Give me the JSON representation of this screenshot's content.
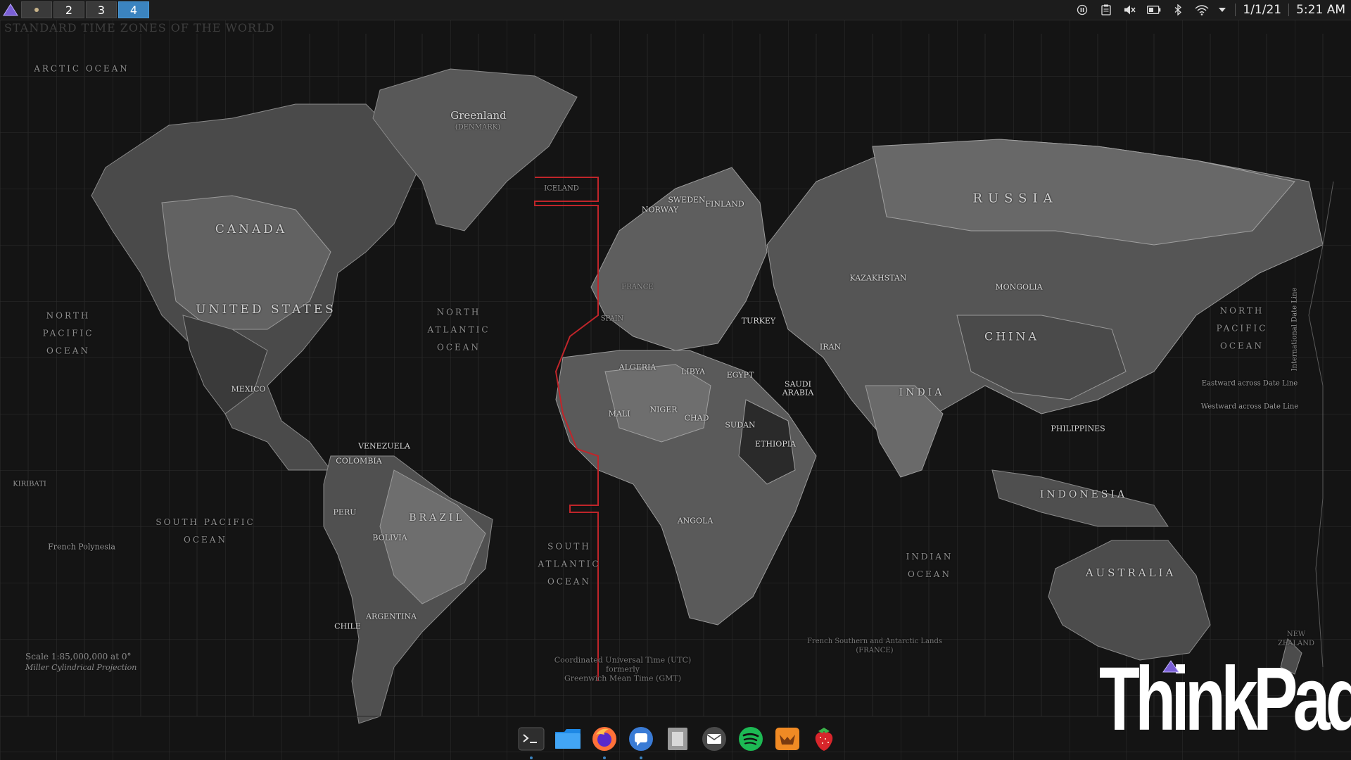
{
  "topbar": {
    "workspaces": [
      {
        "label": "",
        "active": false
      },
      {
        "label": "2",
        "active": false
      },
      {
        "label": "3",
        "active": false
      },
      {
        "label": "4",
        "active": true
      }
    ],
    "tray_icons": [
      "pause-icon",
      "clipboard-icon",
      "volume-muted-icon",
      "battery-icon",
      "bluetooth-icon",
      "wifi-icon",
      "dropdown-arrow-icon"
    ],
    "date": "1/1/21",
    "time": "5:21 AM"
  },
  "wallpaper": {
    "title": "STANDARD TIME ZONES OF THE WORLD",
    "countries": {
      "canada": "CANADA",
      "united_states": "UNITED STATES",
      "mexico": "MEXICO",
      "brazil": "BRAZIL",
      "russia": "RUSSIA",
      "china": "CHINA",
      "india": "INDIA",
      "australia": "AUSTRALIA",
      "indonesia": "INDONESIA",
      "greenland": "Greenland",
      "greenland_sub": "(DENMARK)",
      "algeria": "ALGERIA",
      "libya": "LIBYA",
      "egypt": "EGYPT",
      "sudan": "SUDAN",
      "saudi": "SAUDI",
      "arabia": "ARABIA",
      "iran": "IRAN",
      "kazakhstan": "KAZAKHSTAN",
      "mongolia": "MONGOLIA",
      "niger": "NIGER",
      "chad": "CHAD",
      "mali": "MALI",
      "angola": "ANGOLA",
      "argentina": "ARGENTINA",
      "peru": "PERU",
      "bolivia": "BOLIVIA",
      "colombia": "COLOMBIA",
      "venezuela": "VENEZUELA",
      "ethiopia": "ETHIOPIA",
      "finland": "FINLAND",
      "sweden": "SWEDEN",
      "norway": "NORWAY",
      "turkey": "TURKEY",
      "philippines": "PHILIPPINES",
      "chile": "CHILE",
      "iceland": "ICELAND",
      "spain": "SPAIN",
      "france": "FRANCE",
      "kiribati": "KIRIBATI",
      "french_polynesia": "French Polynesia"
    },
    "oceans": {
      "arctic": "ARCTIC OCEAN",
      "north_pacific_w": "NORTH\nPACIFIC\nOCEAN",
      "north_atlantic": "NORTH\nATLANTIC\nOCEAN",
      "south_pacific": "SOUTH PACIFIC\nOCEAN",
      "south_atlantic": "SOUTH\nATLANTIC\nOCEAN",
      "indian": "INDIAN\nOCEAN",
      "north_pacific_e": "NORTH\nPACIFIC\nOCEAN"
    },
    "scale_text": "Scale 1:85,000,000 at 0°",
    "projection_text": "Miller Cylindrical Projection",
    "utc_note": "Coordinated Universal Time (UTC)\nformerly\nGreenwich Mean Time (GMT)",
    "date_line": "International Date Line",
    "eastward": "Eastward across Date Line",
    "westward": "Westward across Date Line",
    "french_southern": "French Southern and Antarctic Lands\n(FRANCE)",
    "new_zealand": "NEW\nZEALAND"
  },
  "logo": {
    "text": "ThinkPad"
  },
  "dock": {
    "items": [
      {
        "name": "terminal",
        "color": "#2e2e2e"
      },
      {
        "name": "files",
        "color": "#1e88e5"
      },
      {
        "name": "firefox",
        "color": "#ff7139"
      },
      {
        "name": "messages",
        "color": "#3a7bd5"
      },
      {
        "name": "archive",
        "color": "#8a8a8a"
      },
      {
        "name": "mail",
        "color": "#555555"
      },
      {
        "name": "spotify",
        "color": "#1db954"
      },
      {
        "name": "calendar",
        "color": "#f08a24"
      },
      {
        "name": "strawberry",
        "color": "#d8262b"
      }
    ]
  },
  "colors": {
    "accent": "#3b84c0",
    "utc_line": "#c0252a"
  }
}
